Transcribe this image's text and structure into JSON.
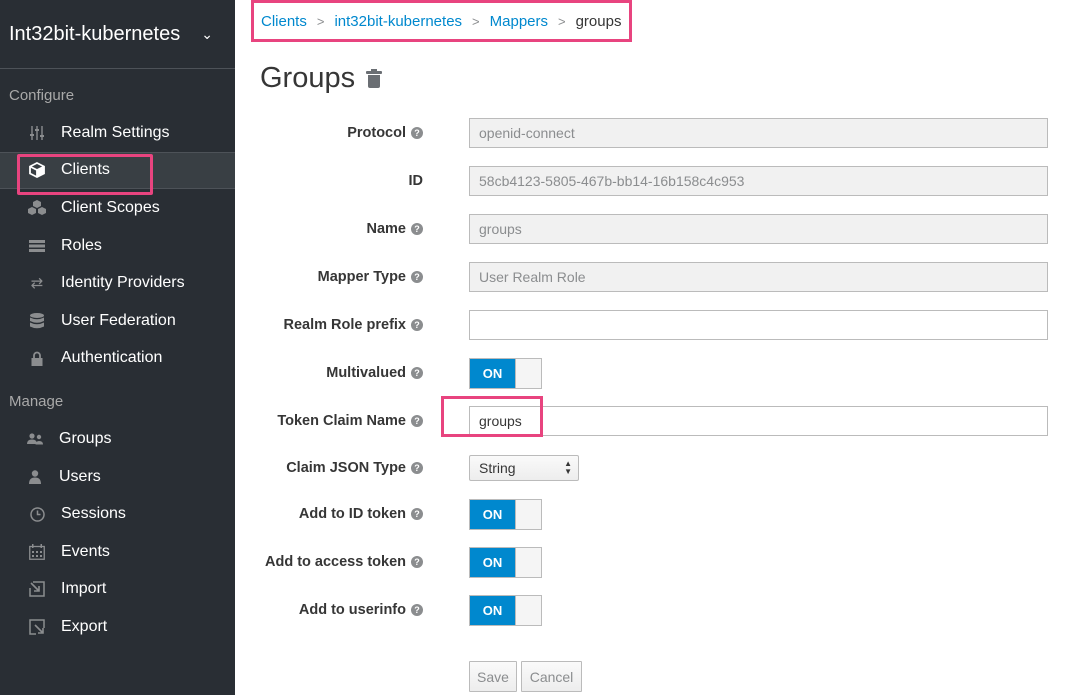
{
  "sidebar": {
    "realm": "Int32bit-kubernetes",
    "configure_heading": "Configure",
    "manage_heading": "Manage",
    "configure_items": [
      {
        "label": "Realm Settings",
        "icon": "sliders-icon"
      },
      {
        "label": "Clients",
        "icon": "cube-icon"
      },
      {
        "label": "Client Scopes",
        "icon": "cubes-icon"
      },
      {
        "label": "Roles",
        "icon": "list-icon"
      },
      {
        "label": "Identity Providers",
        "icon": "exchange-icon"
      },
      {
        "label": "User Federation",
        "icon": "database-icon"
      },
      {
        "label": "Authentication",
        "icon": "lock-icon"
      }
    ],
    "manage_items": [
      {
        "label": "Groups",
        "icon": "users-icon"
      },
      {
        "label": "Users",
        "icon": "user-icon"
      },
      {
        "label": "Sessions",
        "icon": "clock-icon"
      },
      {
        "label": "Events",
        "icon": "calendar-icon"
      },
      {
        "label": "Import",
        "icon": "import-icon"
      },
      {
        "label": "Export",
        "icon": "export-icon"
      }
    ]
  },
  "breadcrumb": {
    "clients": "Clients",
    "client": "int32bit-kubernetes",
    "mappers": "Mappers",
    "current": "groups",
    "separator": ">"
  },
  "page": {
    "title": "Groups"
  },
  "form": {
    "protocol": {
      "label": "Protocol",
      "value": "openid-connect"
    },
    "id": {
      "label": "ID",
      "value": "58cb4123-5805-467b-bb14-16b158c4c953"
    },
    "name": {
      "label": "Name",
      "value": "groups"
    },
    "mapper_type": {
      "label": "Mapper Type",
      "value": "User Realm Role"
    },
    "realm_role_prefix": {
      "label": "Realm Role prefix",
      "value": ""
    },
    "multivalued": {
      "label": "Multivalued",
      "state": "ON"
    },
    "token_claim_name": {
      "label": "Token Claim Name",
      "value": "groups"
    },
    "claim_json_type": {
      "label": "Claim JSON Type",
      "value": "String"
    },
    "add_to_id_token": {
      "label": "Add to ID token",
      "state": "ON"
    },
    "add_to_access_token": {
      "label": "Add to access token",
      "state": "ON"
    },
    "add_to_userinfo": {
      "label": "Add to userinfo",
      "state": "ON"
    },
    "save": "Save",
    "cancel": "Cancel"
  },
  "colors": {
    "accent": "#0088ce",
    "highlight": "#e8447f",
    "sidebar_bg": "#292e34"
  }
}
